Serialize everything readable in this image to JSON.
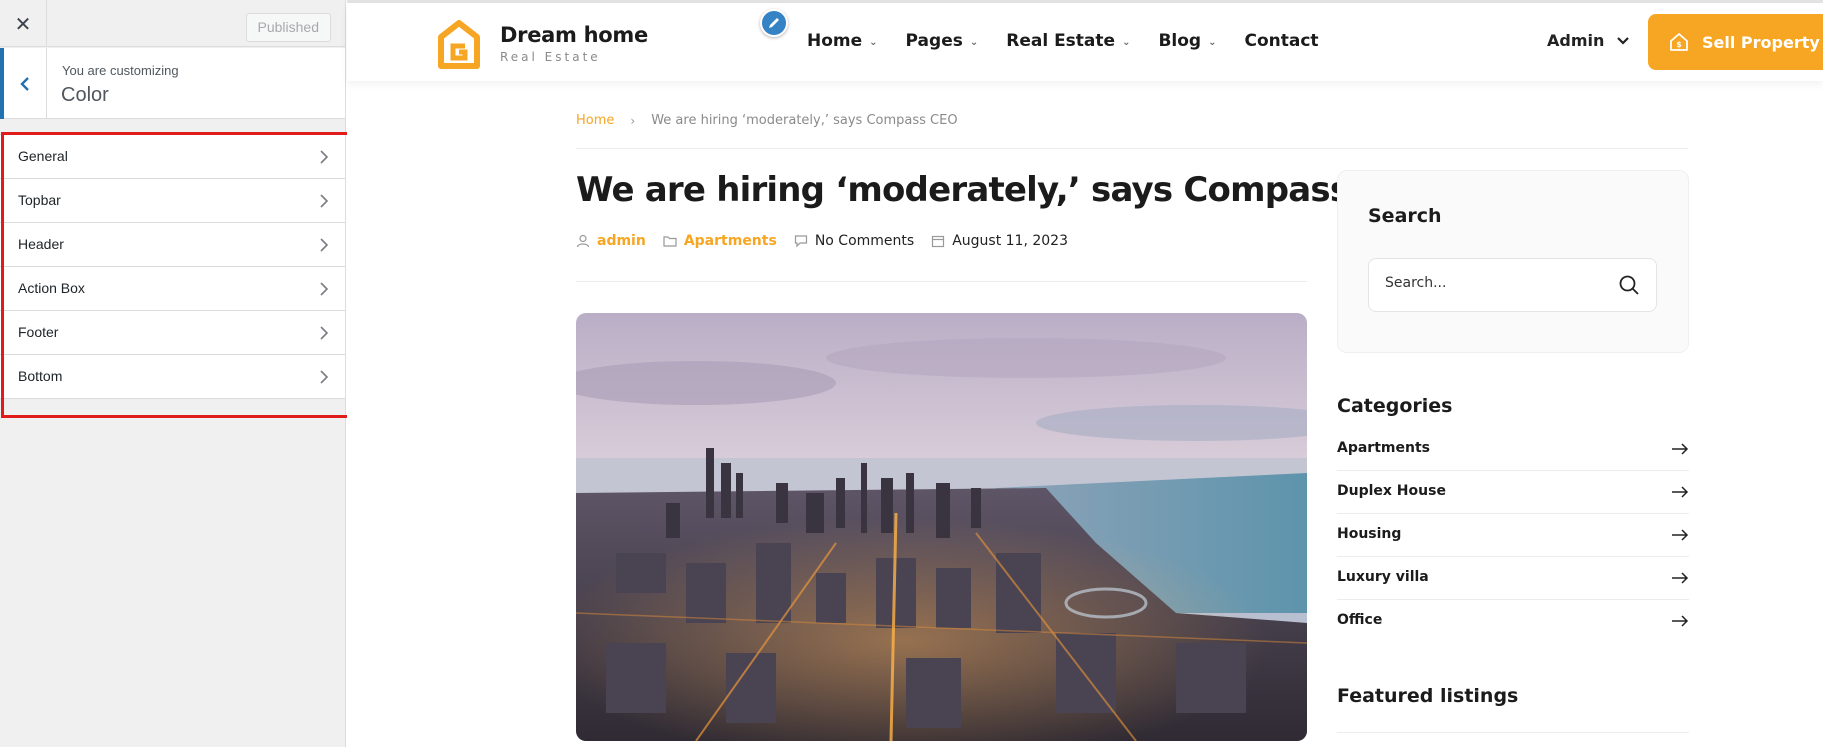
{
  "customizer": {
    "close_label": "✕",
    "published_label": "Published",
    "customizing_label": "You are customizing",
    "section_title": "Color",
    "items": [
      {
        "label": "General"
      },
      {
        "label": "Topbar"
      },
      {
        "label": "Header"
      },
      {
        "label": "Action Box"
      },
      {
        "label": "Footer"
      },
      {
        "label": "Bottom"
      }
    ]
  },
  "site": {
    "logo": {
      "title": "Dream home",
      "subtitle": "Real Estate"
    },
    "nav": [
      {
        "label": "Home",
        "has_dropdown": true
      },
      {
        "label": "Pages",
        "has_dropdown": true
      },
      {
        "label": "Real Estate",
        "has_dropdown": true
      },
      {
        "label": "Blog",
        "has_dropdown": true
      },
      {
        "label": "Contact",
        "has_dropdown": false
      }
    ],
    "admin_label": "Admin",
    "sell_button": "Sell Property",
    "accent_color": "#f6a623"
  },
  "breadcrumb": {
    "home": "Home",
    "separator": "›",
    "current": "We are hiring ‘moderately,’ says Compass CEO"
  },
  "post": {
    "title": "We are hiring ‘moderately,’ says Compass CEO",
    "author": "admin",
    "category": "Apartments",
    "comments": "No Comments",
    "date": "August 11, 2023",
    "image": "city-aerial-photo"
  },
  "widgets": {
    "search": {
      "title": "Search",
      "placeholder": "Search..."
    },
    "categories": {
      "title": "Categories",
      "items": [
        {
          "label": "Apartments"
        },
        {
          "label": "Duplex House"
        },
        {
          "label": "Housing"
        },
        {
          "label": "Luxury villa"
        },
        {
          "label": "Office"
        }
      ]
    },
    "featured": {
      "title": "Featured listings"
    }
  }
}
